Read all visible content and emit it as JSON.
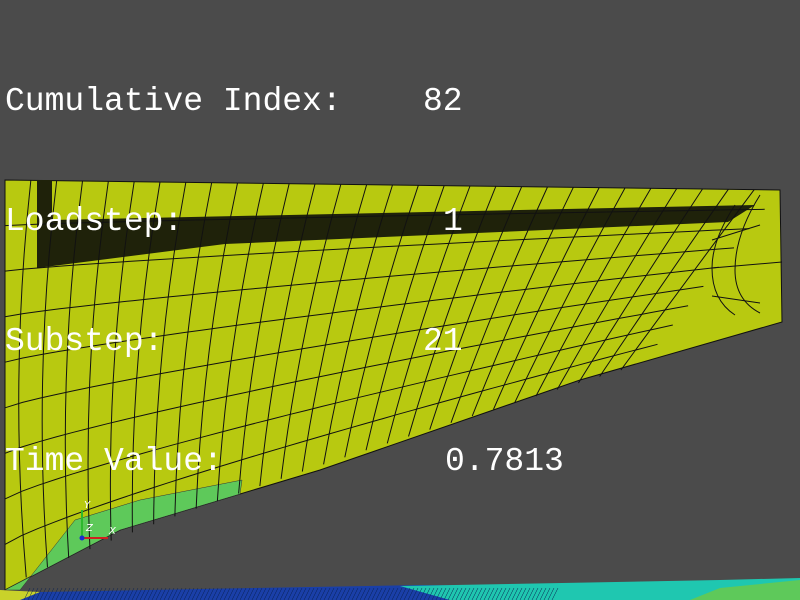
{
  "info": {
    "cumulative_index": {
      "label": "Cumulative Index:",
      "value": "82"
    },
    "loadstep": {
      "label": "Loadstep:",
      "value": "1"
    },
    "substep": {
      "label": "Substep:",
      "value": "21"
    },
    "time_value": {
      "label": "Time Value:",
      "value": "0.7813"
    }
  },
  "triad": {
    "y_label": "Y",
    "z_label": "Z",
    "x_label": "X"
  },
  "colors": {
    "background": "#4b4b4b",
    "mesh_face": "#b8c910",
    "mesh_edge": "#111111",
    "dark_band": "#1f220a",
    "green_region": "#5ec95a",
    "cyan_region": "#1fc7b0",
    "blue_region": "#1a3fa8"
  }
}
